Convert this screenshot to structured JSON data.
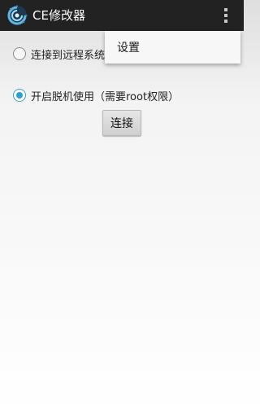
{
  "app": {
    "title": "CE修改器",
    "icon": "ce-logo-icon"
  },
  "action_bar": {
    "overflow_icon": "more-vertical-icon",
    "background_color": "#222222"
  },
  "options": [
    {
      "label": "连接到远程系统",
      "checked": false
    },
    {
      "label": "开启脱机使用（需要root权限）",
      "checked": true
    }
  ],
  "connect_button": {
    "label": "连接"
  },
  "overflow_menu": {
    "items": [
      {
        "label": "设置"
      }
    ]
  },
  "colors": {
    "accent": "#2f9fd0"
  }
}
